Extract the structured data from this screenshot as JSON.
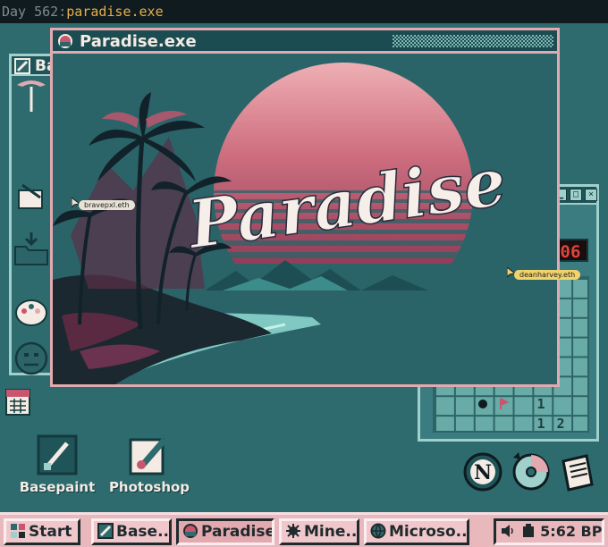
{
  "header": {
    "day_label": "Day 562:",
    "app_name": "paradise.exe"
  },
  "windows": {
    "paradise": {
      "title": "Paradise.exe",
      "art_text": "Paradise"
    },
    "basepaint": {
      "title": "Base"
    },
    "minesweeper": {
      "counter": "06",
      "cells": [
        "1",
        "1",
        "2"
      ]
    }
  },
  "cursors": [
    {
      "name": "bravepxl.eth",
      "color": "#e9e3d6"
    },
    {
      "name": "deanharvey.eth",
      "color": "#f1d36b"
    }
  ],
  "desktop_icons": [
    {
      "label": "Basepaint"
    },
    {
      "label": "Photoshop"
    }
  ],
  "taskbar": {
    "start_label": "Start",
    "items": [
      {
        "label": "Base.."
      },
      {
        "label": "Paradise"
      },
      {
        "label": "Mine.."
      },
      {
        "label": "Microso.."
      }
    ],
    "clock": "5:62 BP"
  },
  "palette": {
    "desktop": "#2e6b6f",
    "accent_pink": "#e3a9b0",
    "sun": "#c8566e",
    "taskbar": "#e9b8bd"
  }
}
